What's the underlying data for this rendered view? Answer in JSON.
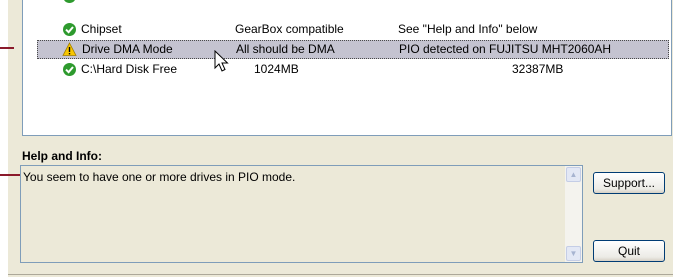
{
  "components_list": {
    "rows": [
      {
        "name": "Chipset",
        "value": "GearBox compatible",
        "detail": "See \"Help and Info\" below",
        "status": "ok",
        "status_icon": "check-circle-icon"
      },
      {
        "name": "Drive DMA Mode",
        "value": "All should be DMA",
        "detail": "PIO detected on FUJITSU MHT2060AH",
        "status": "warning",
        "status_icon": "warning-triangle-icon"
      },
      {
        "name": "C:\\Hard Disk Free",
        "value": "1024MB",
        "detail": "32387MB",
        "status": "ok",
        "status_icon": "check-circle-icon"
      }
    ]
  },
  "help_section": {
    "label": "Help and Info:",
    "message": "You seem to have one or more drives in PIO mode."
  },
  "buttons": {
    "support_label": "Support...",
    "quit_label": "Quit"
  },
  "colors": {
    "ok_green": "#2e9a2e",
    "warning_yellow": "#f7c600",
    "callout_red": "#8b1a2b",
    "window_bg": "#ece9d8",
    "border_blue": "#7f9db9"
  }
}
